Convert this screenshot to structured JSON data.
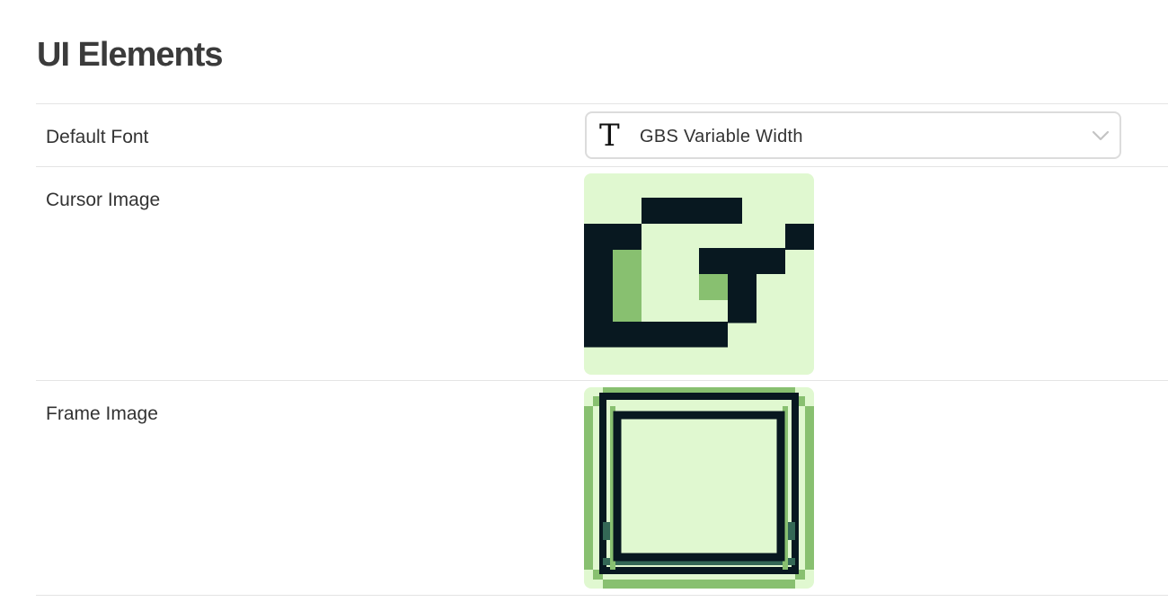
{
  "section": {
    "title": "UI Elements"
  },
  "settings": [
    {
      "label": "Default Font",
      "select_value": "GBS Variable Width",
      "icon": "font-T-icon"
    },
    {
      "label": "Cursor Image",
      "icon": "cursor-image"
    },
    {
      "label": "Frame Image",
      "icon": "frame-image"
    }
  ],
  "colors": {
    "lightest": "#e0f8d0",
    "light": "#88c070",
    "dark": "#346856",
    "darkest": "#081820"
  }
}
